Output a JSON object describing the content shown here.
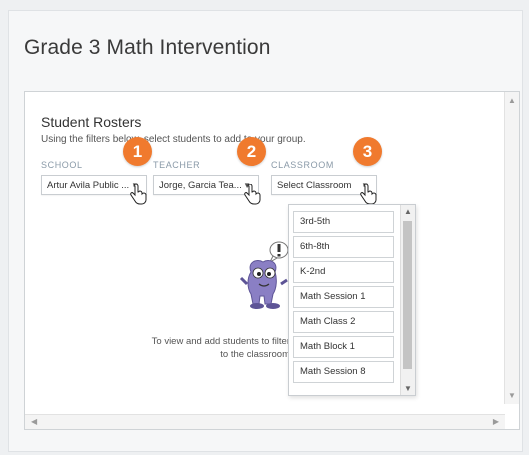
{
  "page": {
    "title": "Grade 3 Math Intervention"
  },
  "rosters": {
    "title": "Student Rosters",
    "subtitle": "Using the filters below, select students to add to your group.",
    "filters": [
      {
        "label": "SCHOOL",
        "value": "Artur Avila Public ...",
        "step": "1"
      },
      {
        "label": "TEACHER",
        "value": "Jorge, Garcia Tea...",
        "step": "2"
      },
      {
        "label": "CLASSROOM",
        "value": "Select Classroom",
        "step": "3"
      }
    ],
    "classroom_options": [
      "3rd-5th",
      "6th-8th",
      "K-2nd",
      "Math Session 1",
      "Math Class 2",
      "Math Block 1",
      "Math Session 8"
    ],
    "empty_state": "To view and add students to filter to the classroom"
  },
  "colors": {
    "step_badge": "#f07a2e",
    "mascot": "#8a7fc4"
  },
  "icons": {
    "dropdown_caret": "caret-down-icon",
    "cursor": "hand-pointer-icon",
    "mascot": "mascot-exclaim-icon"
  }
}
